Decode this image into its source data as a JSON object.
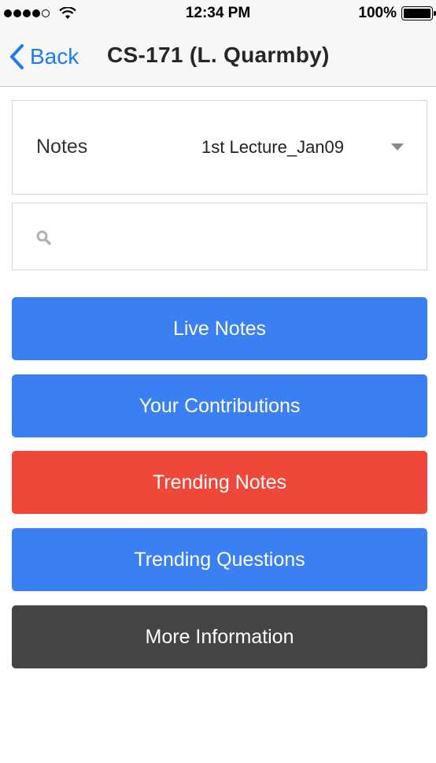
{
  "status_bar": {
    "time": "12:34 PM",
    "battery_percent": "100%",
    "signal_bars_filled": 4,
    "signal_bars_total": 5
  },
  "nav": {
    "back_label": "Back",
    "title": "CS-171 (L. Quarmby)"
  },
  "notes_selector": {
    "label": "Notes",
    "selected_value": "1st Lecture_Jan09"
  },
  "search": {
    "placeholder": "",
    "value": ""
  },
  "buttons": {
    "live_notes": "Live Notes",
    "your_contributions": "Your Contributions",
    "trending_notes": "Trending Notes",
    "trending_questions": "Trending Questions",
    "more_information": "More Information"
  },
  "colors": {
    "accent_blue": "#3b80f3",
    "accent_red": "#ef473a",
    "dark_gray": "#444444",
    "link_blue": "#1a7cf5"
  }
}
